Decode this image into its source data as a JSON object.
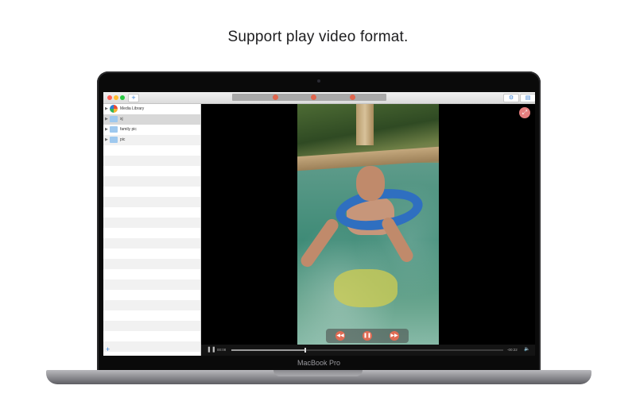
{
  "caption": "Support play video format.",
  "device_label": "MacBook Pro",
  "toolbar": {
    "add_icon": "plus-icon",
    "transport_icons": [
      "rewind-icon",
      "play-icon",
      "fast-forward-icon"
    ],
    "right_icons": [
      "gear-icon",
      "sidebar-toggle-icon"
    ]
  },
  "sidebar": {
    "items": [
      {
        "label": "Media Library",
        "icon": "media-library-icon"
      },
      {
        "label": "xj",
        "icon": "folder-icon",
        "selected": true
      },
      {
        "label": "family pic",
        "icon": "folder-icon"
      },
      {
        "label": "pic",
        "icon": "folder-icon"
      }
    ],
    "add_label": "+"
  },
  "player": {
    "elapsed": "00:08",
    "remaining": "-00:22",
    "progress": 0.27,
    "overlay_buttons": [
      "rewind-icon",
      "pause-icon",
      "fast-forward-icon"
    ]
  },
  "colors": {
    "accent": "#e06b53",
    "folder": "#9ec8ee",
    "selection": "#d8d8d8"
  }
}
